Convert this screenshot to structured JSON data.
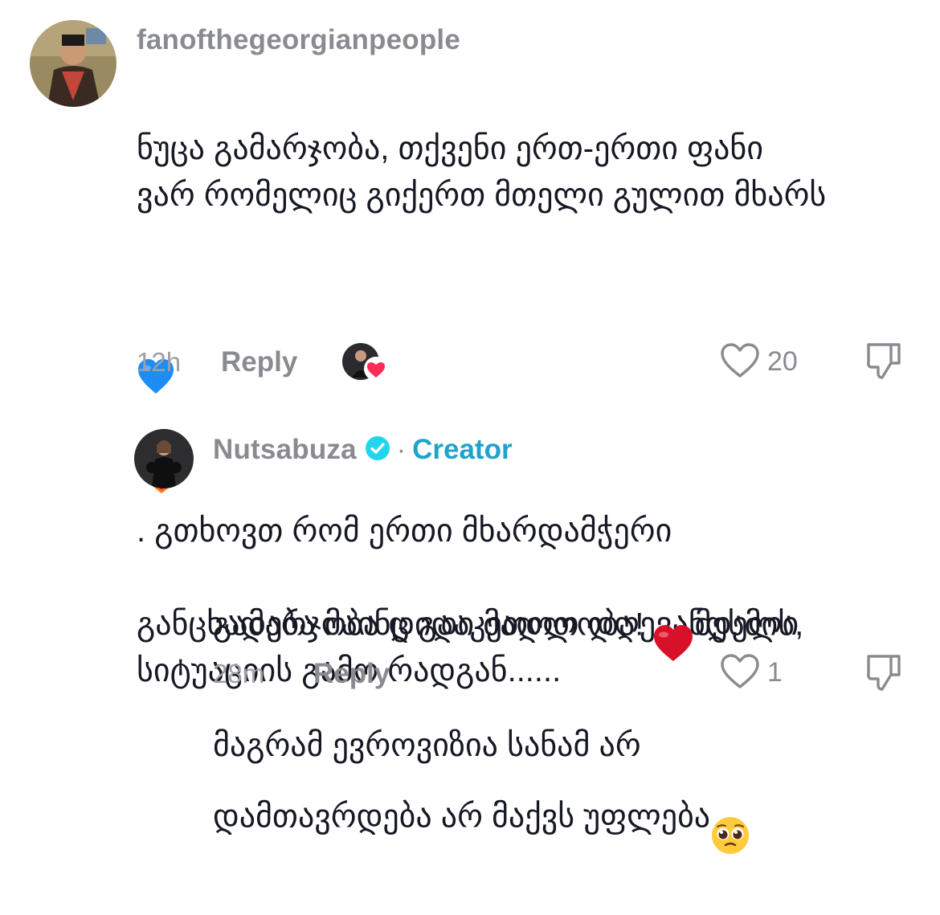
{
  "comments": [
    {
      "username": "fanofthegeorgianpeople",
      "text": "ნუცა გამარჯობა, თქვენი ერთ-ერთი ფანი\nვარ რომელიც გიქერთ მთელი გულით მხარს",
      "text_line3_suffix": ". გთხოვთ რომ ერთი მხარდამჭერი",
      "text_rest": "განცხადება მაინც გააკეთოთ დღევანდელი\nსიტუაციის გამო რადგან......",
      "emojis": [
        "blue-heart",
        "heart-on-fire"
      ],
      "time": "12h",
      "reply_label": "Reply",
      "likes": "20"
    },
    {
      "username": "Nutsabuza",
      "creator_label": "Creator",
      "separator": "·",
      "text_line1_a": "გამარჯობა დიდი მადლობა! ",
      "text_line1_b": "მესმის,",
      "text_rest": "მაგრამ ევროვიზია სანამ არ\nდამთავრდება არ მაქვს უფლება",
      "emojis": [
        "red-heart",
        "pleading-face"
      ],
      "time": "28m",
      "reply_label": "Reply",
      "likes": "1"
    }
  ],
  "colors": {
    "text": "#161823",
    "secondary": "#8a8b91",
    "creator": "#20a3c9",
    "verified": "#20d5ec",
    "heart_badge": "#fe2c55"
  }
}
